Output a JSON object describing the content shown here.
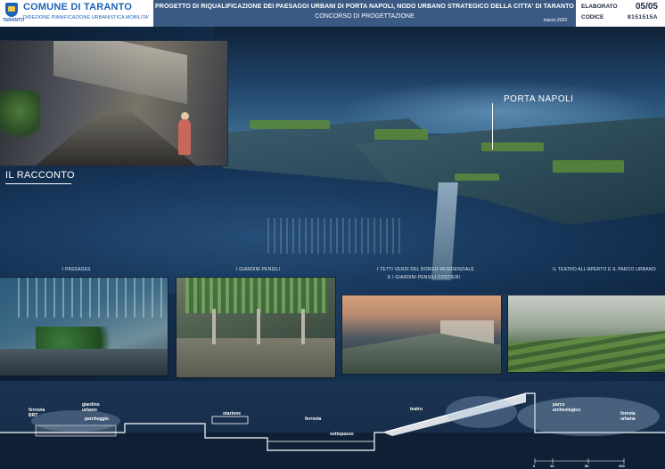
{
  "header": {
    "logo_small": "TARANTO",
    "logo_title": "COMUNE DI TARANTO",
    "logo_sub": "DIREZIONE PIANIFICAZIONE URBANISTICA MOBILITA'",
    "title_main": "PROGETTO DI RIQUALIFICAZIONE DEI PAESAGGI URBANI DI PORTA NAPOLI, NODO URBANO STRATEGICO DELLA CITTA' DI TARANTO",
    "title_sub": "CONCORSO DI PROGETTAZIONE",
    "date": "marzo 2020",
    "elaborato_label": "ELABORATO",
    "elaborato_value": "05/05",
    "codice_label": "CODICE",
    "codice_value": "8151515A"
  },
  "labels": {
    "porta_napoli": "PORTA NAPOLI",
    "racconto": "IL RACCONTO"
  },
  "captions": {
    "passages": "I PASSAGES",
    "giardini": "I GIARDINI PENSILI",
    "tetti_1": "I TETTI VERDI DEL BORGO RESIDENZIALE",
    "tetti_2": "E I GIARDINI PENSILI COSTIERI",
    "teatro": "IL TEATRO ALL'APERTO  E  IL PARCO URBANO"
  },
  "section_labels": {
    "ferrovia_brt_1": "ferrovia",
    "ferrovia_brt_2": "BRT",
    "giardino_1": "giardino",
    "giardino_2": "urbano",
    "parcheggio": "parcheggio",
    "stazione": "stazione",
    "ferrovia": "ferrovia",
    "sottopasso": "sottopasso",
    "teatro": "teatro",
    "parco_1": "parco",
    "parco_2": "archeologico",
    "foresta_1": "foresta",
    "foresta_2": "urbana"
  },
  "scale": {
    "s0": "0",
    "s1": "10",
    "s2": "50",
    "s3": "100"
  },
  "colors": {
    "header_band": "#3a5a84",
    "brand_blue": "#1e63b8",
    "background": "#0b1a2e"
  }
}
